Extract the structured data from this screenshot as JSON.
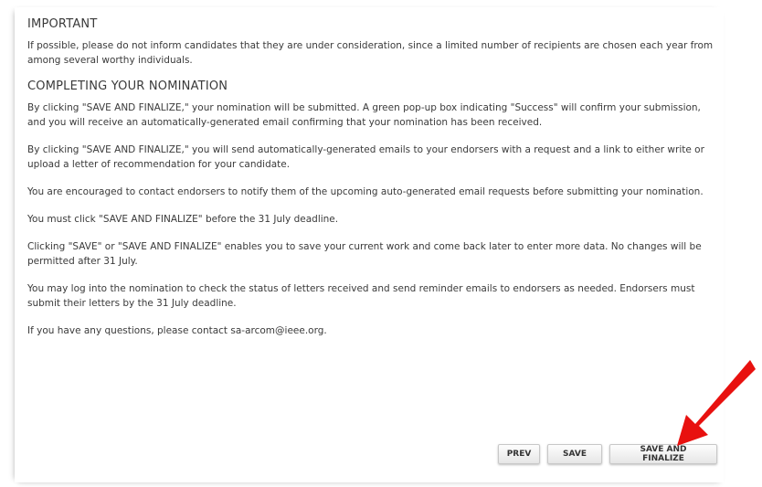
{
  "sections": {
    "important": {
      "heading": "IMPORTANT",
      "text": "If possible, please do not inform candidates that they are under consideration, since a limited number of recipients are chosen each year from among several worthy individuals."
    },
    "completing": {
      "heading": "COMPLETING YOUR NOMINATION",
      "paragraphs": [
        "By clicking \"SAVE AND FINALIZE,\" your nomination will be submitted. A green pop-up box indicating \"Success\" will confirm your submission, and you will receive an automatically-generated email confirming that your nomination has been received.",
        "By clicking \"SAVE AND FINALIZE,\" you will send automatically-generated emails to your endorsers with a request and a link to either write or upload a letter of recommendation for your candidate.",
        "You are encouraged to contact endorsers to notify them of the upcoming auto-generated email requests before submitting your nomination.",
        "You must click \"SAVE AND FINALIZE\" before the 31 July deadline.",
        "Clicking \"SAVE\" or \"SAVE AND FINALIZE\" enables you to save your current work and come back later to enter more data. No changes will be permitted after 31 July.",
        "You may log into the nomination to check the status of letters received and send reminder emails to endorsers as needed. Endorsers must submit their letters by the 31 July deadline.",
        "If you have any questions, please contact sa-arcom@ieee.org."
      ]
    }
  },
  "buttons": {
    "prev": "PREV",
    "save": "SAVE",
    "save_finalize": "SAVE AND FINALIZE"
  },
  "colors": {
    "arrow": "#e8110f",
    "text": "#3a3a3a"
  }
}
